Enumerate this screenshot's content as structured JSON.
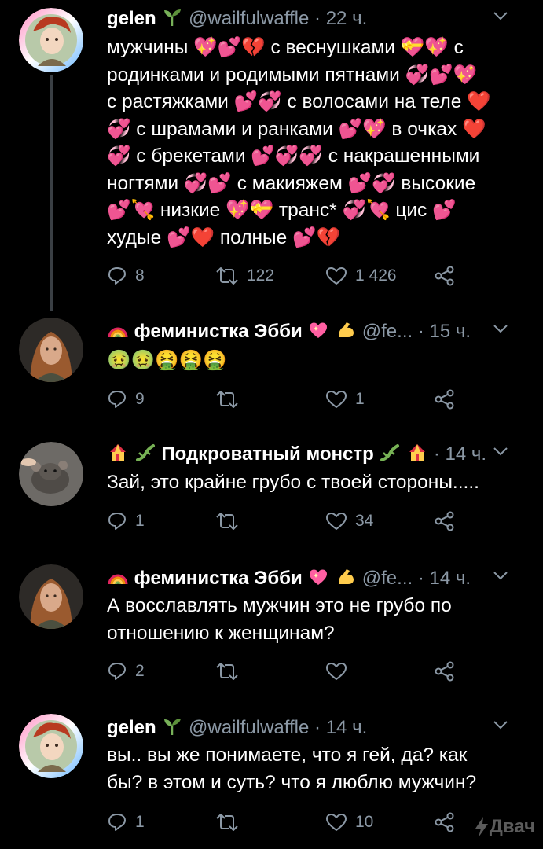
{
  "tweets": [
    {
      "name": "gelen",
      "handle": "@wailfulwaffle",
      "time": "22 ч.",
      "lines": [
        "мужчины 💖💕💔 с веснушками 💝💖 с",
        "родинками и родимыми пятнами 💞💕💖",
        "с растяжками 💕💞 с волосами на теле ❤️",
        "💞 с шрамами и ранками 💕💖 в очках ❤️",
        "💞 с брекетами 💕💞💞 с накрашенными",
        "ногтями 💞💕 с макияжем 💕💞 высокие",
        "💕💘 низкие 💖💝 транс* 💞💘 цис 💕",
        "худые 💕❤️ полные 💕💔"
      ],
      "replies": "8",
      "retweets": "122",
      "likes": "1 426"
    },
    {
      "name": "феминистка Эбби",
      "handle": "@fe...",
      "time": "15 ч.",
      "lines": [
        "🤢🤢🤮🤮🤮"
      ],
      "replies": "9",
      "retweets": "",
      "likes": "1"
    },
    {
      "name": "Подкроватный монстр",
      "handle": "",
      "time": "14 ч.",
      "lines": [
        "Зай, это крайне грубо с твоей стороны....."
      ],
      "replies": "1",
      "retweets": "",
      "likes": "34"
    },
    {
      "name": "феминистка Эбби",
      "handle": "@fe...",
      "time": "14 ч.",
      "lines": [
        "А восславлять мужчин это не грубо по",
        "отношению к женщинам?"
      ],
      "replies": "2",
      "retweets": "",
      "likes": ""
    },
    {
      "name": "gelen",
      "handle": "@wailfulwaffle",
      "time": "14 ч.",
      "lines": [
        "вы.. вы же понимаете, что я гей, да? как",
        "бы? в этом и суть? что я люблю мужчин?"
      ],
      "replies": "1",
      "retweets": "",
      "likes": "10"
    }
  ],
  "watermark": "Двач",
  "colors": {
    "background": "#000000",
    "text": "#ffffff",
    "secondary": "#8b98a5",
    "thread_line": "#3a3f44",
    "heart_red": "#e0245e",
    "heart_pink": "#ff5fa2"
  },
  "icons": [
    "reply-icon",
    "retweet-icon",
    "like-icon",
    "share-icon",
    "caret-down-icon",
    "sprout-icon",
    "rainbow-icon",
    "flexed-biceps-icon",
    "circus-tent-icon",
    "lizard-icon"
  ]
}
